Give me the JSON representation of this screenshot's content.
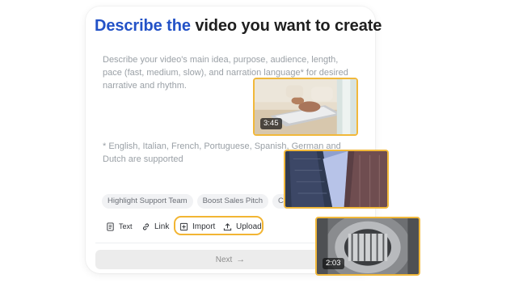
{
  "card": {
    "title_accent": "Describe the",
    "title_rest": " video you want to create",
    "description": "Describe your video's main idea, purpose, audience, length, pace (fast, medium, slow), and narration language* for desired narrative and rhythm.",
    "note": "* English, Italian, French, Portuguese, Spanish, German and Dutch are supported",
    "chips": [
      "Highlight Support Team",
      "Boost Sales Pitch",
      "Cre"
    ],
    "toolbar": {
      "text_label": "Text",
      "link_label": "Link",
      "import_label": "Import",
      "upload_label": "Upload"
    },
    "next_label": "Next",
    "accent_color": "#2352c7",
    "highlight_color": "#f2b533"
  },
  "thumbnails": [
    {
      "duration": "3:45",
      "icon": "laptop-typing-image"
    },
    {
      "duration": "",
      "icon": "skyscraper-image"
    },
    {
      "duration": "2:03",
      "icon": "machinery-image"
    }
  ]
}
